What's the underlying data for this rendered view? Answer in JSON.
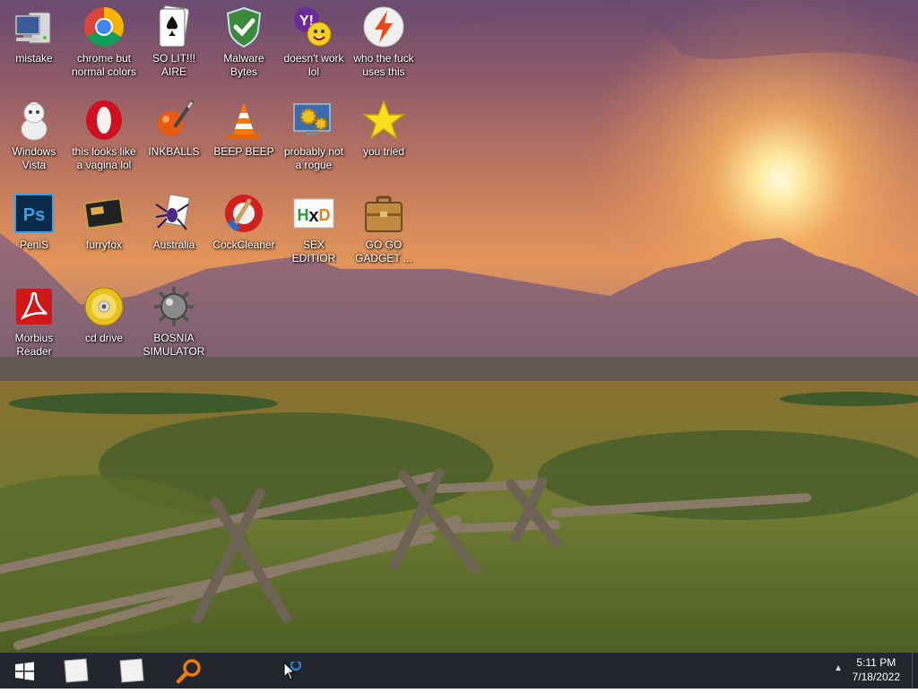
{
  "desktop": {
    "icons": [
      {
        "id": "mistake",
        "label": "mistake",
        "icon": "computer-icon"
      },
      {
        "id": "chrome",
        "label": "chrome but normal colors",
        "icon": "chrome-icon"
      },
      {
        "id": "solitaire",
        "label": "SO LIT!!! AIRE",
        "icon": "solitaire-card-icon"
      },
      {
        "id": "malware",
        "label": "Malware Bytes",
        "icon": "shield-check-icon"
      },
      {
        "id": "yahoo",
        "label": "doesn't work lol",
        "icon": "yahoo-messenger-icon"
      },
      {
        "id": "whofuck",
        "label": "who the fuck uses this",
        "icon": "bolt-circle-icon"
      },
      {
        "id": "vista",
        "label": "Windows Vista",
        "icon": "robot-mascot-icon"
      },
      {
        "id": "opera",
        "label": "this looks like a vagina lol",
        "icon": "opera-icon"
      },
      {
        "id": "inkballs",
        "label": "INKBALLS",
        "icon": "inkball-icon"
      },
      {
        "id": "vlc",
        "label": "BEEP BEEP",
        "icon": "traffic-cone-icon"
      },
      {
        "id": "rogue",
        "label": "probably not a rogue",
        "icon": "gears-monitor-icon"
      },
      {
        "id": "star",
        "label": "you tried",
        "icon": "star-icon"
      },
      {
        "id": "ps",
        "label": "PeniS",
        "icon": "photoshop-icon"
      },
      {
        "id": "furryfox",
        "label": "furryfox",
        "icon": "media-card-icon"
      },
      {
        "id": "australia",
        "label": "Australia",
        "icon": "spider-solitaire-icon"
      },
      {
        "id": "ccleaner",
        "label": "CockCleaner",
        "icon": "ccleaner-icon"
      },
      {
        "id": "hxd",
        "label": "SEX EDITIOR",
        "icon": "hex-editor-icon"
      },
      {
        "id": "gadget",
        "label": "GO GO GADGET ...",
        "icon": "briefcase-icon"
      },
      {
        "id": "reader",
        "label": "Morbius Reader",
        "icon": "pdf-reader-icon"
      },
      {
        "id": "cd",
        "label": "cd drive",
        "icon": "cd-disc-icon"
      },
      {
        "id": "bosnia",
        "label": "BOSNIA SIMULATOR",
        "icon": "mine-icon"
      }
    ]
  },
  "taskbar": {
    "buttons": [
      {
        "id": "start",
        "icon": "windows-start-icon"
      },
      {
        "id": "note1",
        "icon": "blank-document-icon"
      },
      {
        "id": "note2",
        "icon": "blank-document-icon"
      },
      {
        "id": "search",
        "icon": "search-icon"
      }
    ],
    "time": "5:11 PM",
    "date": "7/18/2022"
  },
  "colors": {
    "taskbar": "#23272d",
    "label_text": "#ffffff"
  }
}
